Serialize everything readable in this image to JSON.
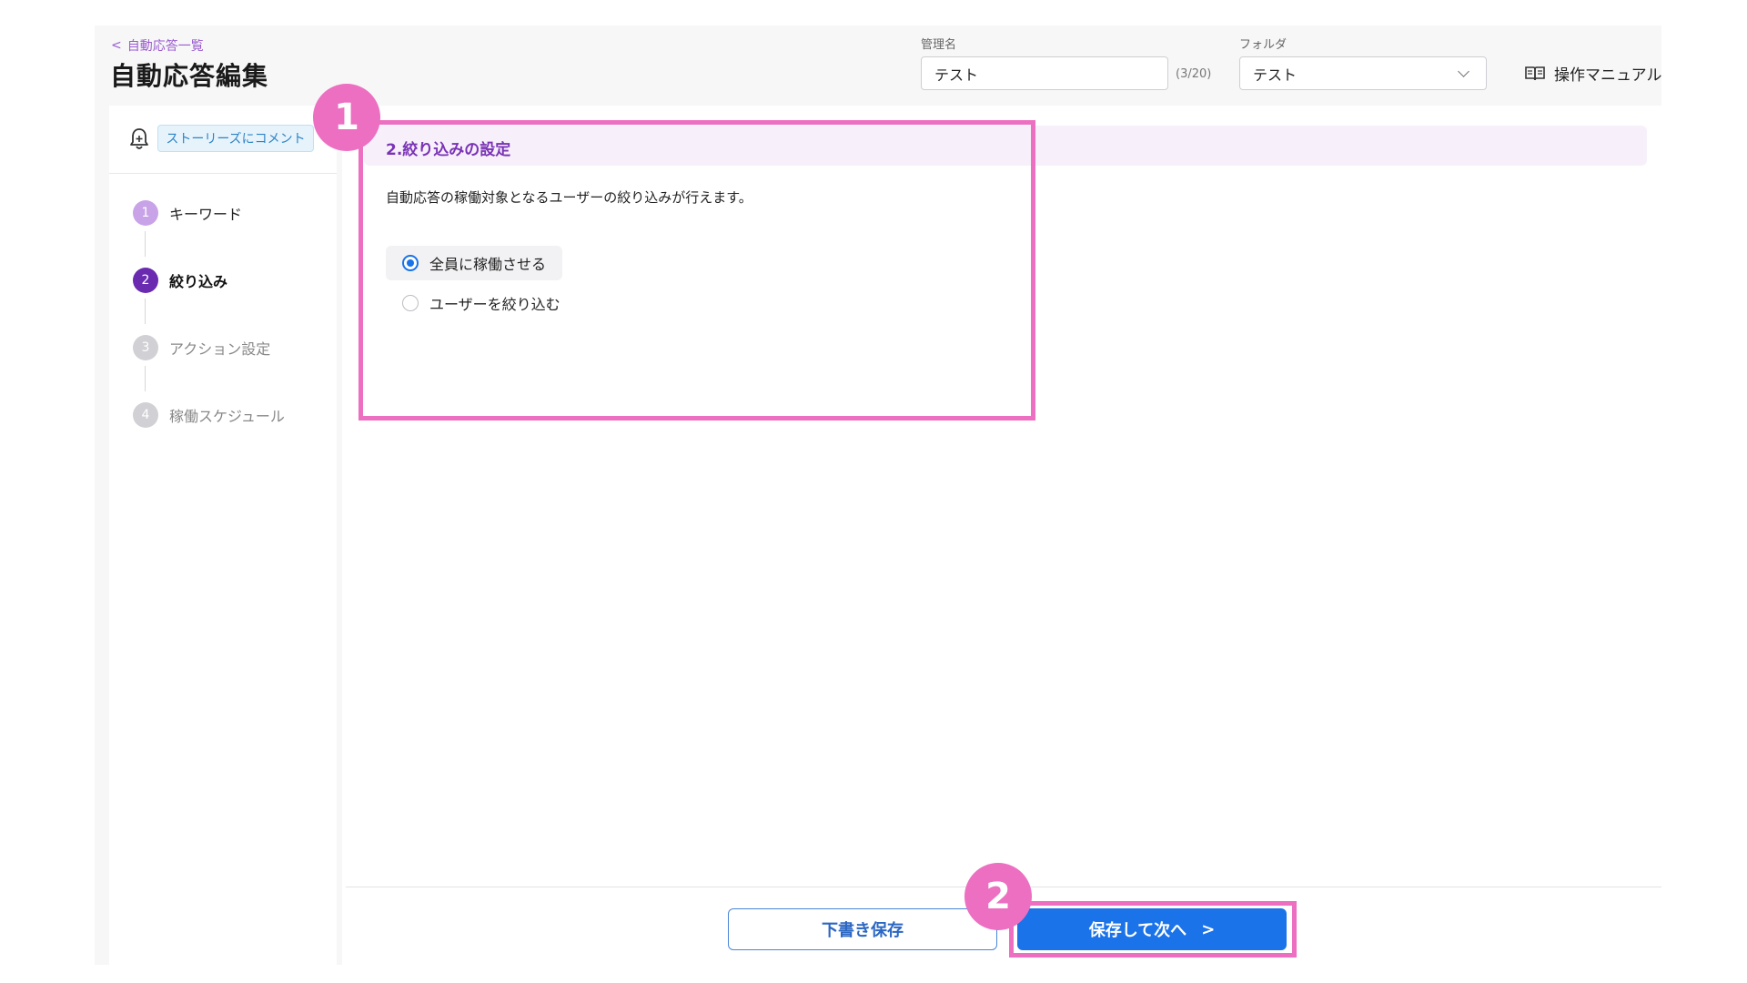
{
  "header": {
    "back_label": "自動応答一覧",
    "title": "自動応答編集",
    "name_label": "管理名",
    "name_value": "テスト",
    "name_counter": "(3/20)",
    "folder_label": "フォルダ",
    "folder_value": "テスト",
    "manual_label": "操作マニュアル"
  },
  "sidebar": {
    "type_chip": "ストーリーズにコメント",
    "steps": [
      {
        "num": "1",
        "label": "キーワード",
        "state": "done"
      },
      {
        "num": "2",
        "label": "絞り込み",
        "state": "active"
      },
      {
        "num": "3",
        "label": "アクション設定",
        "state": "pending"
      },
      {
        "num": "4",
        "label": "稼働スケジュール",
        "state": "pending"
      }
    ]
  },
  "main": {
    "section_title": "2.絞り込みの設定",
    "description": "自動応答の稼働対象となるユーザーの絞り込みが行えます。",
    "options": [
      {
        "label": "全員に稼働させる",
        "selected": true
      },
      {
        "label": "ユーザーを絞り込む",
        "selected": false
      }
    ]
  },
  "footer": {
    "draft_label": "下書き保存",
    "next_label": "保存して次へ",
    "next_arrow": ">"
  },
  "annotations": {
    "badge_1": "1",
    "badge_2": "2"
  },
  "colors": {
    "accent_purple": "#7a33b5",
    "step_done": "#c9a3e8",
    "step_active": "#6a2bb0",
    "step_pending": "#d0d0d5",
    "primary_blue": "#1a73e8",
    "highlight_pink": "#ec6fc1"
  }
}
